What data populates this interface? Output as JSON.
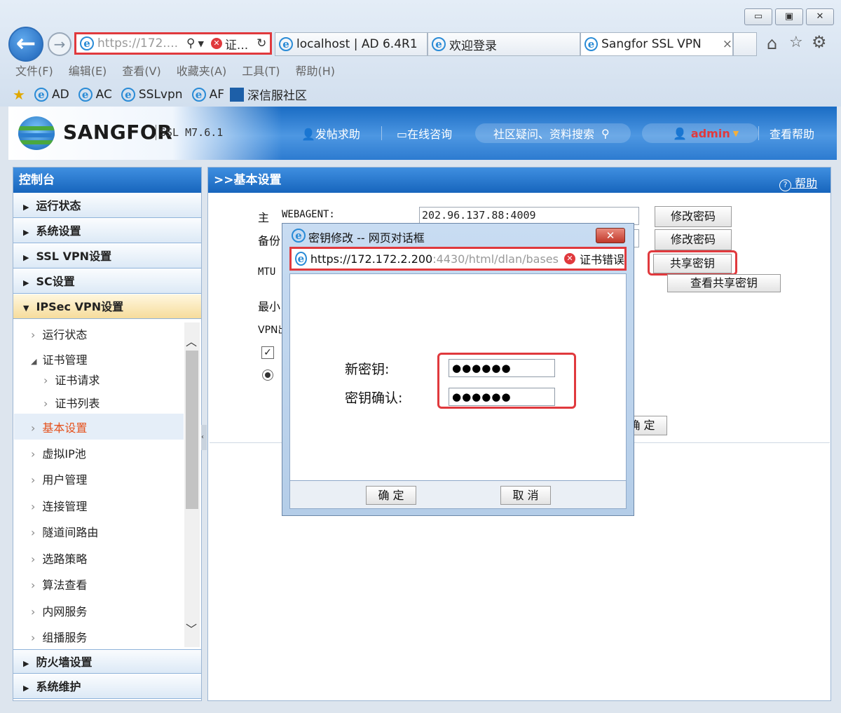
{
  "browser": {
    "window_buttons": [
      "▭",
      "▣",
      "✕"
    ],
    "address_text": "https://172....",
    "address_cert": "证...",
    "tabs": [
      {
        "label": "localhost | AD 6.4R1"
      },
      {
        "label": "欢迎登录"
      },
      {
        "label": "Sangfor SSL VPN",
        "close": "×"
      }
    ],
    "menu": [
      "文件(F)",
      "编辑(E)",
      "查看(V)",
      "收藏夹(A)",
      "工具(T)",
      "帮助(H)"
    ],
    "favorites": [
      "AD",
      "AC",
      "SSLvpn",
      "AF",
      "深信服社区"
    ]
  },
  "header": {
    "brand": "SANGFOR",
    "version": "SSL M7.6.1",
    "post_help": "发帖求助",
    "online_consult": "在线咨询",
    "search_placeholder": "社区疑问、资料搜索",
    "user": "admin",
    "view_help": "查看帮助"
  },
  "sidebar": {
    "title": "控制台",
    "sections_top": [
      "运行状态",
      "系统设置",
      "SSL VPN设置",
      "SC设置"
    ],
    "open_section": "IPSec VPN设置",
    "items": {
      "run_status": "运行状态",
      "cert_mgmt": "证书管理",
      "cert_request": "证书请求",
      "cert_list": "证书列表",
      "basic_settings": "基本设置",
      "virtual_ip": "虚拟IP池",
      "user_mgmt": "用户管理",
      "conn_mgmt": "连接管理",
      "tunnel_route": "隧道间路由",
      "route_policy": "选路策略",
      "algo_view": "算法查看",
      "lan_service": "内网服务",
      "multicast": "组播服务"
    },
    "sections_bottom": [
      "防火墙设置",
      "系统维护"
    ]
  },
  "main": {
    "title": ">>基本设置",
    "help": "帮助",
    "labels": {
      "primary": "主",
      "webagent": "WEBAGENT:",
      "backup": "备份",
      "mtu": "MTU",
      "min": "最小",
      "vpn": "VPN出"
    },
    "webagent_value": "202.96.137.88:4009",
    "buttons": {
      "change_pw_1": "修改密码",
      "change_pw_2": "修改密码",
      "shared_key": "共享密钥",
      "view_shared_key": "查看共享密钥",
      "confirm_bg": "确 定"
    }
  },
  "dialog": {
    "title": "密钥修改 -- 网页对话框",
    "close": "✕",
    "url_main": "https://172.172.2.200",
    "url_rest": ":4430/html/dlan/bases",
    "cert_error": "证书错误",
    "new_key_label": "新密钥:",
    "confirm_key_label": "密钥确认:",
    "new_key_value": "●●●●●●",
    "confirm_key_value": "●●●●●●",
    "ok": "确 定",
    "cancel": "取 消"
  },
  "colors": {
    "highlight": "#e0393d",
    "header_blue": "#2d7bd0",
    "selected_text": "#e5501b"
  }
}
